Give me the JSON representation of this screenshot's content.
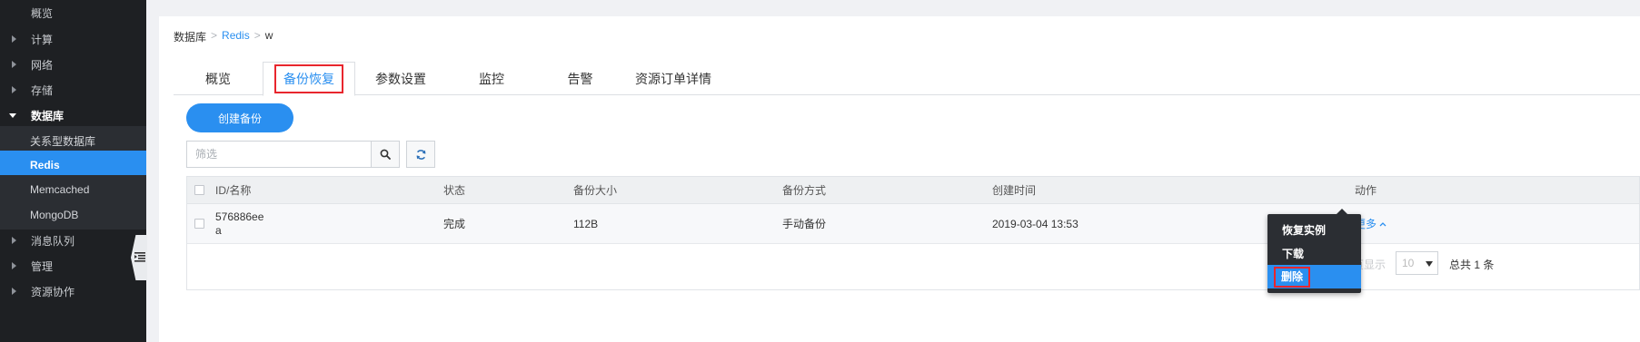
{
  "sidebar": {
    "items": [
      {
        "label": "概览",
        "type": "top"
      },
      {
        "label": "计算",
        "type": "group"
      },
      {
        "label": "网络",
        "type": "group"
      },
      {
        "label": "存储",
        "type": "group"
      },
      {
        "label": "数据库",
        "type": "group-open"
      },
      {
        "label": "关系型数据库",
        "type": "sub"
      },
      {
        "label": "Redis",
        "type": "sub-active"
      },
      {
        "label": "Memcached",
        "type": "sub"
      },
      {
        "label": "MongoDB",
        "type": "sub"
      },
      {
        "label": "消息队列",
        "type": "group"
      },
      {
        "label": "管理",
        "type": "group"
      },
      {
        "label": "资源协作",
        "type": "group"
      }
    ]
  },
  "breadcrumb": {
    "root": "数据库",
    "sep1": ">",
    "mid": "Redis",
    "sep2": ">",
    "current": "w"
  },
  "tabs": [
    {
      "label": "概览"
    },
    {
      "label": "备份恢复",
      "active": true
    },
    {
      "label": "参数设置"
    },
    {
      "label": "监控"
    },
    {
      "label": "告警"
    },
    {
      "label": "资源订单详情"
    }
  ],
  "toolbar": {
    "create_label": "创建备份",
    "search_placeholder": "筛选"
  },
  "table": {
    "headers": [
      "ID/名称",
      "状态",
      "备份大小",
      "备份方式",
      "创建时间",
      "动作"
    ],
    "rows": [
      {
        "id": "576886ee\na",
        "status": "完成",
        "size": "112B",
        "method": "手动备份",
        "created": "2019-03-04 13:53",
        "action": "更多"
      }
    ]
  },
  "pager": {
    "per_page_hidden": "页显示",
    "per_page": "10",
    "total": "总共 1 条"
  },
  "action_menu": {
    "items": [
      {
        "label": "恢复实例"
      },
      {
        "label": "下载"
      },
      {
        "label": "删除",
        "active": true
      }
    ]
  },
  "colors": {
    "accent": "#2a8ff0",
    "highlight": "#e8262d",
    "sidebar_bg": "#1e2023"
  }
}
